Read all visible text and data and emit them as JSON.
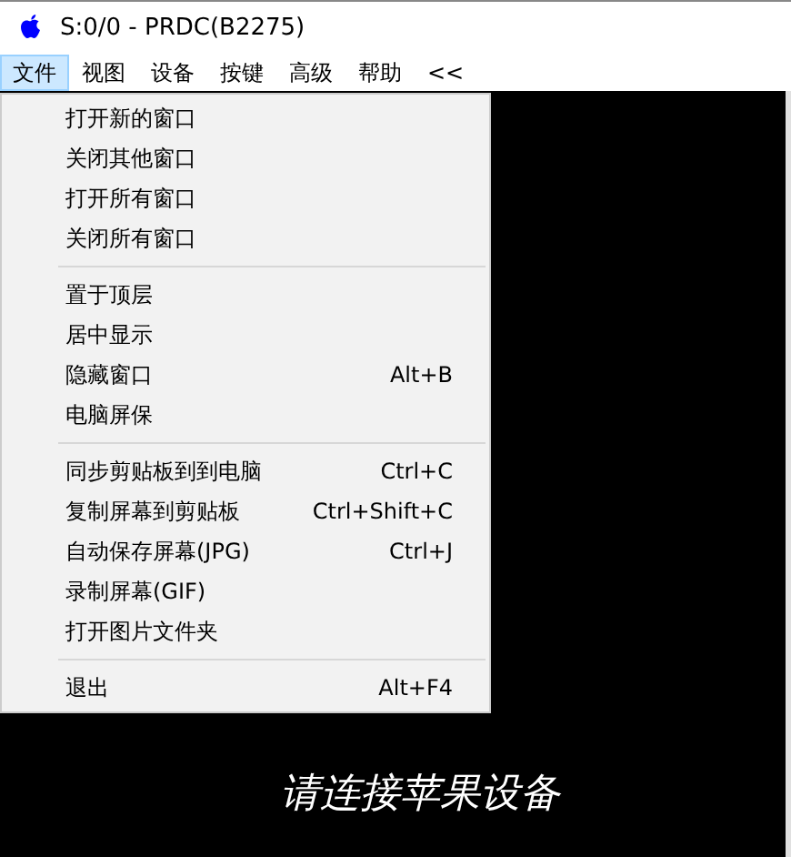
{
  "window": {
    "title": "S:0/0 - PRDC(B2275)"
  },
  "menubar": [
    {
      "label": "文件",
      "selected": true
    },
    {
      "label": "视图",
      "selected": false
    },
    {
      "label": "设备",
      "selected": false
    },
    {
      "label": "按键",
      "selected": false
    },
    {
      "label": "高级",
      "selected": false
    },
    {
      "label": "帮助",
      "selected": false
    },
    {
      "label": "<<",
      "selected": false
    }
  ],
  "menu": {
    "groups": [
      [
        {
          "label": "打开新的窗口"
        },
        {
          "label": "关闭其他窗口"
        },
        {
          "label": "打开所有窗口"
        },
        {
          "label": "关闭所有窗口"
        }
      ],
      [
        {
          "label": "置于顶层"
        },
        {
          "label": "居中显示"
        },
        {
          "label": "隐藏窗口",
          "shortcut": "Alt+B"
        },
        {
          "label": "电脑屏保"
        }
      ],
      [
        {
          "label": "同步剪贴板到到电脑",
          "shortcut": "Ctrl+C"
        },
        {
          "label": "复制屏幕到剪贴板",
          "shortcut": "Ctrl+Shift+C"
        },
        {
          "label": "自动保存屏幕(JPG)",
          "shortcut": "Ctrl+J"
        },
        {
          "label": "录制屏幕(GIF)"
        },
        {
          "label": "打开图片文件夹"
        }
      ],
      [
        {
          "label": "退出",
          "shortcut": "Alt+F4"
        }
      ]
    ]
  },
  "screen": {
    "message": "请连接苹果设备"
  }
}
